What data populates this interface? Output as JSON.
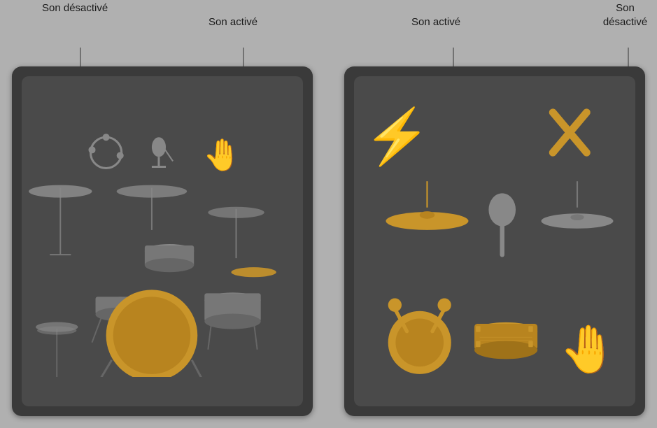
{
  "labels": {
    "left_desactive": "Son\ndésactivé",
    "left_active": "Son activé",
    "right_active": "Son activé",
    "right_desactive": "Son\ndésactivé"
  },
  "left_panel": {
    "top_icons": [
      "tambourine",
      "microphone",
      "hand-gold"
    ],
    "drum_kit": "full drum kit with cymbals, toms, snare, bass drum"
  },
  "right_panel": {
    "icons": [
      {
        "name": "lightning",
        "state": "gold"
      },
      {
        "name": "cross-sticks",
        "state": "gold"
      },
      {
        "name": "suspended-cymbal",
        "state": "gold"
      },
      {
        "name": "maraca",
        "state": "gray"
      },
      {
        "name": "ride-cymbal",
        "state": "gray"
      },
      {
        "name": "bass-drum-mallet",
        "state": "gold"
      },
      {
        "name": "snare-drum",
        "state": "gold"
      },
      {
        "name": "hand",
        "state": "gold"
      }
    ]
  }
}
